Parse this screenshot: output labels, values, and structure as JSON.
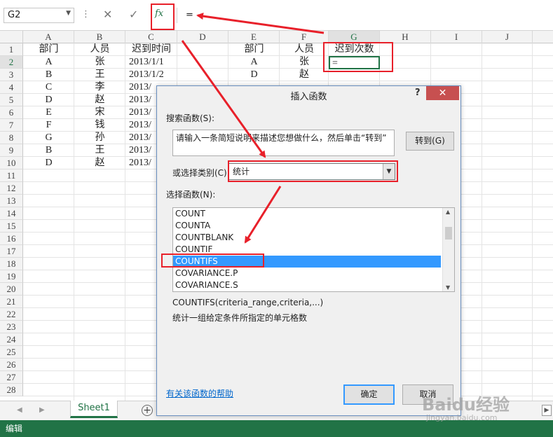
{
  "formula_bar": {
    "name_box": "G2",
    "dots": "⋮",
    "cancel_icon": "✕",
    "enter_icon": "✓",
    "fx_label": "fx",
    "formula": "="
  },
  "grid": {
    "columns": [
      "A",
      "B",
      "C",
      "D",
      "E",
      "F",
      "G",
      "H",
      "I",
      "J"
    ],
    "rows": [
      "1",
      "2",
      "3",
      "4",
      "5",
      "6",
      "7",
      "8",
      "9",
      "10",
      "11",
      "12",
      "13",
      "14",
      "15",
      "16",
      "17",
      "18",
      "19",
      "20",
      "21",
      "22",
      "23",
      "24",
      "25",
      "26",
      "27",
      "28"
    ],
    "headers_left": {
      "dept": "部门",
      "person": "人员",
      "late_time": "迟到时间"
    },
    "headers_right": {
      "dept": "部门",
      "person": "人员",
      "late_count": "迟到次数"
    },
    "data_rows": [
      {
        "dept": "A",
        "person": "张",
        "date": "2013/1/1"
      },
      {
        "dept": "B",
        "person": "王",
        "date": "2013/1/2"
      },
      {
        "dept": "C",
        "person": "李",
        "date": "2013/"
      },
      {
        "dept": "D",
        "person": "赵",
        "date": "2013/"
      },
      {
        "dept": "E",
        "person": "宋",
        "date": "2013/"
      },
      {
        "dept": "F",
        "person": "钱",
        "date": "2013/"
      },
      {
        "dept": "G",
        "person": "孙",
        "date": "2013/"
      },
      {
        "dept": "B",
        "person": "王",
        "date": "2013/"
      },
      {
        "dept": "D",
        "person": "赵",
        "date": "2013/"
      }
    ],
    "right_rows": [
      {
        "dept": "A",
        "person": "张"
      },
      {
        "dept": "D",
        "person": "赵"
      }
    ],
    "active_cell_value": "="
  },
  "sheet_tabs": {
    "active": "Sheet1",
    "add": "+",
    "prev": "◀",
    "next": "▶",
    "scroll_right": "▶"
  },
  "status_bar": {
    "mode": "编辑"
  },
  "dialog": {
    "title": "插入函数",
    "help": "?",
    "close": "✕",
    "search_label": "搜索函数(S):",
    "search_placeholder": "请输入一条简短说明来描述您想做什么，然后单击“转到”",
    "goto_button": "转到(G)",
    "category_label": "或选择类别(C):",
    "category_value": "统计",
    "func_list_label": "选择函数(N):",
    "functions": [
      "COUNT",
      "COUNTA",
      "COUNTBLANK",
      "COUNTIF",
      "COUNTIFS",
      "COVARIANCE.P",
      "COVARIANCE.S"
    ],
    "selected_function": "COUNTIFS",
    "syntax": "COUNTIFS(criteria_range,criteria,...)",
    "description": "统计一组给定条件所指定的单元格数",
    "help_link": "有关该函数的帮助",
    "ok_button": "确定",
    "cancel_button": "取消"
  },
  "watermark": {
    "main": "Baidu经验",
    "sub": "jingyan.baidu.com"
  },
  "colors": {
    "excel_green": "#217346",
    "annotation_red": "#e8202a",
    "selection_blue": "#3399ff"
  }
}
